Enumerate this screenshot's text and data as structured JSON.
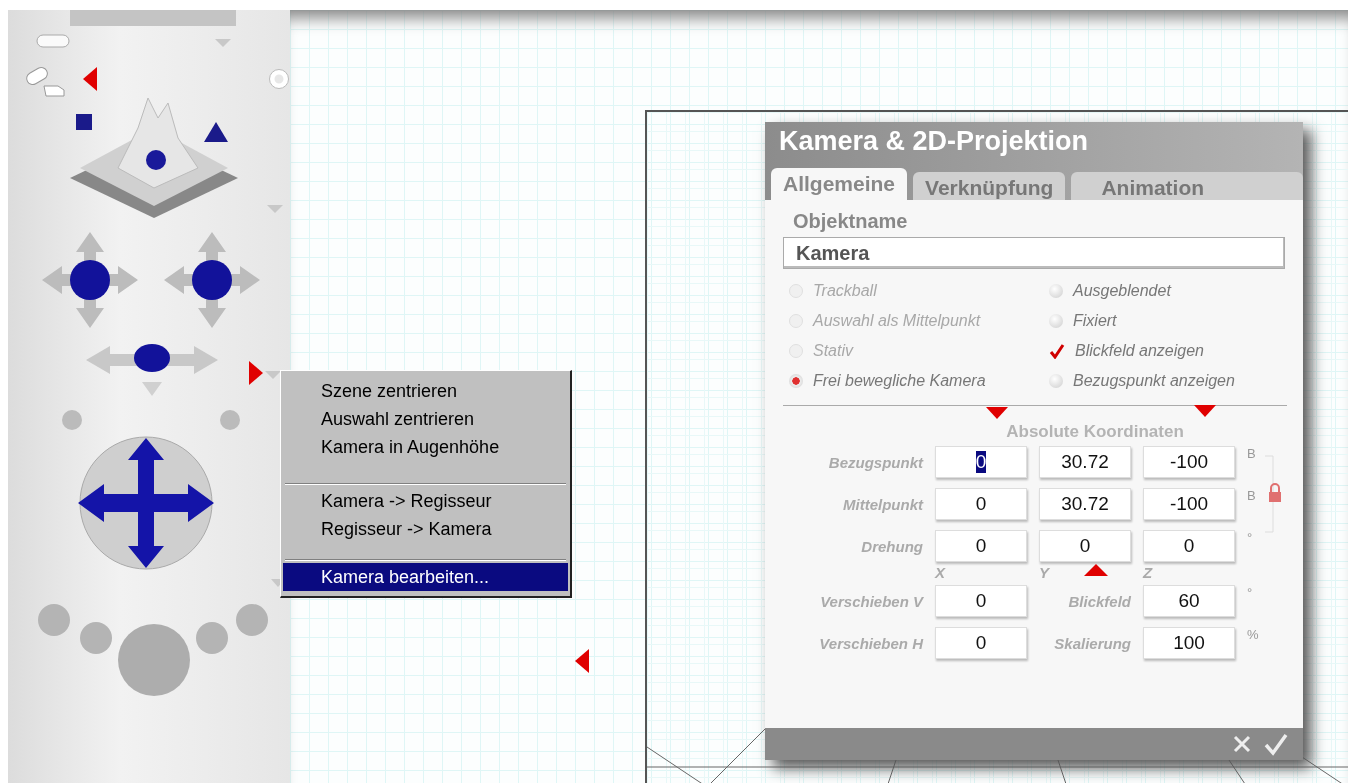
{
  "context_menu": {
    "groups": [
      [
        {
          "label": "Szene zentrieren",
          "selected": false
        },
        {
          "label": "Auswahl zentrieren",
          "selected": false
        },
        {
          "label": "Kamera in Augenhöhe",
          "selected": false
        }
      ],
      [
        {
          "label": "Kamera -> Regisseur",
          "selected": false
        },
        {
          "label": "Regisseur -> Kamera",
          "selected": false
        }
      ],
      [
        {
          "label": "Kamera bearbeiten...",
          "selected": true
        }
      ]
    ]
  },
  "dialog": {
    "title": "Kamera & 2D-Projektion",
    "tabs": [
      {
        "label": "Allgemeine",
        "selected": true
      },
      {
        "label": "Verknüpfung",
        "selected": false
      },
      {
        "label": "Animation",
        "selected": false
      }
    ],
    "object_name_label": "Objektname",
    "object_name": "Kamera",
    "modes": [
      {
        "label": "Trackball",
        "selected": false,
        "disabled": true
      },
      {
        "label": "Auswahl als Mittelpunkt",
        "selected": false,
        "disabled": true
      },
      {
        "label": "Stativ",
        "selected": false,
        "disabled": true
      },
      {
        "label": "Frei bewegliche Kamera",
        "selected": true,
        "disabled": false
      }
    ],
    "options": [
      {
        "label": "Ausgeblendet",
        "checked": false
      },
      {
        "label": "Fixiert",
        "checked": false
      },
      {
        "label": "Blickfeld anzeigen",
        "checked": true
      },
      {
        "label": "Bezugspunkt anzeigen",
        "checked": false
      }
    ],
    "coords_heading": "Absolute Koordinaten",
    "rows": [
      {
        "label": "Bezugspunkt",
        "unit": "B",
        "cells": [
          {
            "kind": "field",
            "value": "0",
            "focused": true
          },
          {
            "kind": "field",
            "value": "30.72",
            "focused": false
          },
          {
            "kind": "field",
            "value": "-100",
            "focused": false
          }
        ]
      },
      {
        "label": "Mittelpunkt",
        "unit": "B",
        "cells": [
          {
            "kind": "field",
            "value": "0",
            "focused": false
          },
          {
            "kind": "field",
            "value": "30.72",
            "focused": false
          },
          {
            "kind": "field",
            "value": "-100",
            "focused": false
          }
        ]
      },
      {
        "label": "Drehung",
        "unit": "°",
        "cells": [
          {
            "kind": "field",
            "value": "0",
            "focused": false
          },
          {
            "kind": "field",
            "value": "0",
            "focused": false
          },
          {
            "kind": "field",
            "value": "0",
            "focused": false
          }
        ]
      }
    ],
    "axes": [
      "X",
      "Y",
      "Z"
    ],
    "rows2": [
      {
        "label": "Verschieben V",
        "unit": "°",
        "cells": [
          {
            "kind": "field",
            "value": "0",
            "focused": false
          },
          {
            "kind": "label",
            "value": "Blickfeld"
          },
          {
            "kind": "field",
            "value": "60",
            "focused": false
          }
        ]
      },
      {
        "label": "Verschieben H",
        "unit": "%",
        "cells": [
          {
            "kind": "field",
            "value": "0",
            "focused": false
          },
          {
            "kind": "label",
            "value": "Skalierung"
          },
          {
            "kind": "field",
            "value": "100",
            "focused": false
          }
        ]
      }
    ]
  }
}
